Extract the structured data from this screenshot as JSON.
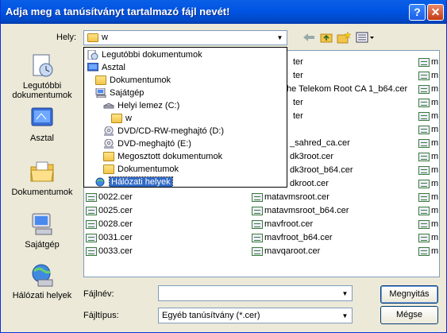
{
  "window": {
    "title": "Adja meg a tanúsítványt tartalmazó fájl nevét!"
  },
  "toolbar": {
    "look_in_label": "Hely:",
    "look_in_value": "w"
  },
  "places": [
    {
      "label": "Legutóbbi dokumentumok",
      "icon": "recent-documents-icon"
    },
    {
      "label": "Asztal",
      "icon": "desktop-icon"
    },
    {
      "label": "Dokumentumok",
      "icon": "my-documents-icon"
    },
    {
      "label": "Sajátgép",
      "icon": "my-computer-icon"
    },
    {
      "label": "Hálózati helyek",
      "icon": "network-places-icon"
    }
  ],
  "dropdown": [
    {
      "label": "Legutóbbi dokumentumok",
      "icon": "recent-documents-icon",
      "indent": 0
    },
    {
      "label": "Asztal",
      "icon": "desktop-icon",
      "indent": 0
    },
    {
      "label": "Dokumentumok",
      "icon": "my-documents-icon",
      "indent": 1
    },
    {
      "label": "Sajátgép",
      "icon": "my-computer-icon",
      "indent": 1
    },
    {
      "label": "Helyi lemez (C:)",
      "icon": "hard-drive-icon",
      "indent": 2
    },
    {
      "label": "w",
      "icon": "folder-open-icon",
      "indent": 3
    },
    {
      "label": "DVD/CD-RW-meghajtó (D:)",
      "icon": "cd-drive-icon",
      "indent": 2
    },
    {
      "label": "DVD-meghajtó (E:)",
      "icon": "cd-drive-icon",
      "indent": 2
    },
    {
      "label": "Megosztott dokumentumok",
      "icon": "folder-icon",
      "indent": 2
    },
    {
      "label": "Dokumentumok",
      "icon": "folder-icon",
      "indent": 2
    },
    {
      "label": "Hálózati helyek",
      "icon": "network-places-icon",
      "indent": 1,
      "selected": true
    }
  ],
  "files_col1": [
    "0022.cer",
    "0025.cer",
    "0028.cer",
    "0031.cer",
    "0033.cer"
  ],
  "files_col2_partial": [
    "ter",
    "ter",
    "the Telekom Root CA 1_b64.cer",
    "ter",
    "ter",
    "",
    "_sahred_ca.cer",
    "dk3root.cer",
    "dk3root_b64.cer",
    "dkroot.cer"
  ],
  "files_col2": [
    "matavmsroot.cer",
    "matavmsroot_b64.cer",
    "mavfroot.cer",
    "mavfroot_b64.cer",
    "mavqaroot.cer"
  ],
  "files_col3_partial": [
    "m",
    "m",
    "m",
    "m",
    "m",
    "m",
    "m",
    "m",
    "m",
    "m",
    "m",
    "m",
    "m",
    "m",
    "m"
  ],
  "filename": {
    "label": "Fájlnév:",
    "value": ""
  },
  "filetype": {
    "label": "Fájltípus:",
    "value": "Egyéb tanúsítvány (*.cer)"
  },
  "buttons": {
    "open": "Megnyitás",
    "cancel": "Mégse"
  }
}
